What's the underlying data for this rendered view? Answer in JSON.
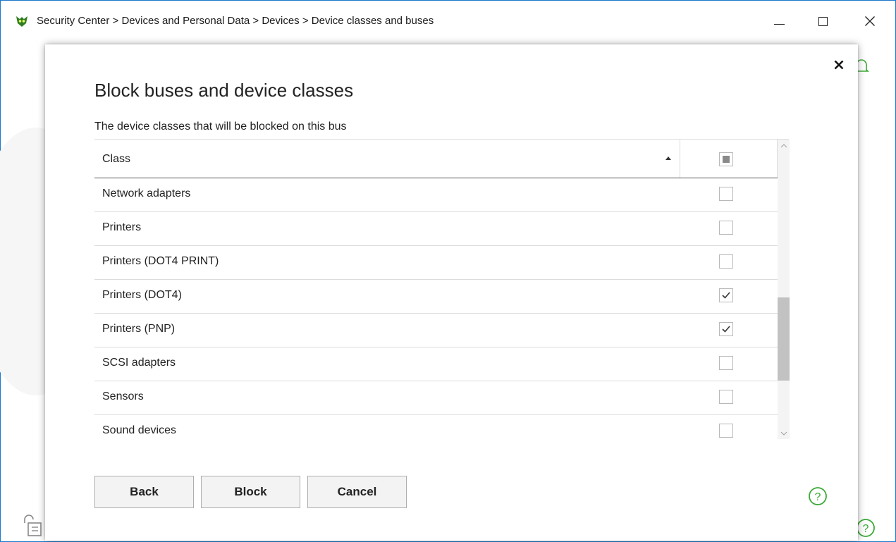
{
  "window": {
    "title": "Security Center > Devices and Personal Data > Devices > Device classes and buses",
    "minimize_icon": "minimize-icon",
    "maximize_icon": "maximize-icon",
    "close_icon": "close-icon"
  },
  "dialog": {
    "title": "Block buses and device classes",
    "subtitle": "The device classes that will be blocked on this bus",
    "close_icon": "close-icon"
  },
  "table": {
    "header": {
      "class_label": "Class",
      "sort": "ascending",
      "select_all_state": "indeterminate"
    },
    "rows": [
      {
        "label": "Network adapters",
        "checked": false
      },
      {
        "label": "Printers",
        "checked": false
      },
      {
        "label": "Printers (DOT4 PRINT)",
        "checked": false
      },
      {
        "label": "Printers (DOT4)",
        "checked": true
      },
      {
        "label": "Printers (PNP)",
        "checked": true
      },
      {
        "label": "SCSI adapters",
        "checked": false
      },
      {
        "label": "Sensors",
        "checked": false
      },
      {
        "label": "Sound devices",
        "checked": false
      }
    ]
  },
  "buttons": {
    "back": "Back",
    "block": "Block",
    "cancel": "Cancel"
  },
  "colors": {
    "window_border": "#1979ca",
    "accent_green": "#3aaa35",
    "checkbox_border": "#b9b9b9"
  }
}
